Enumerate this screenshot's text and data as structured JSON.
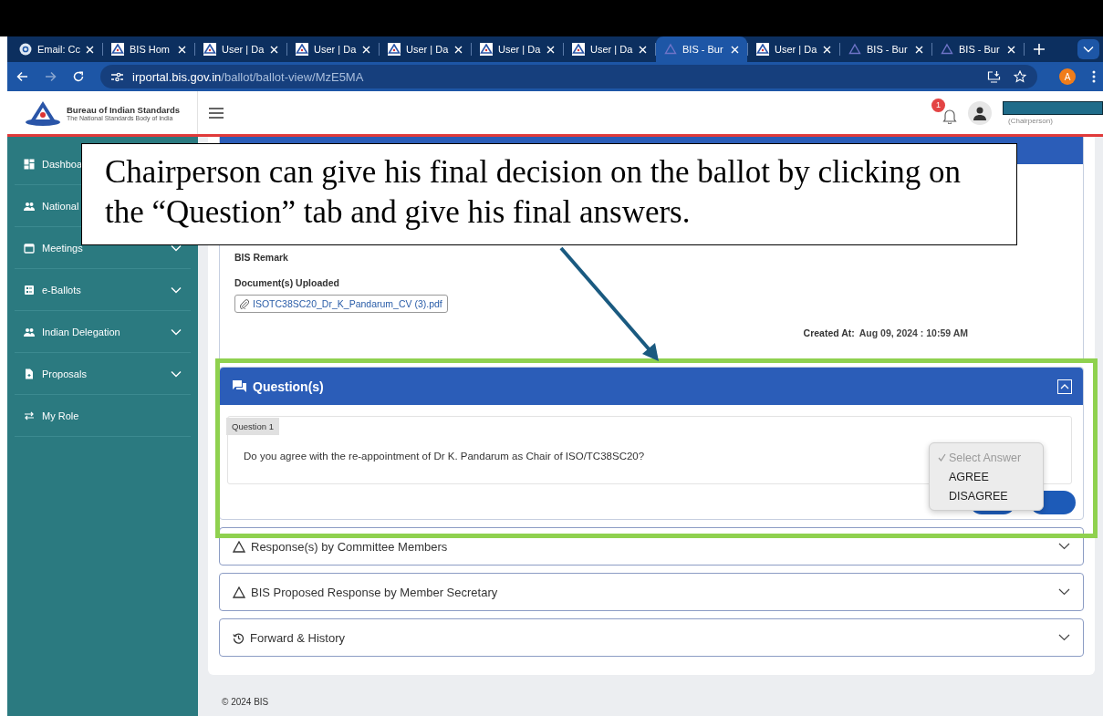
{
  "browser": {
    "tabs": [
      {
        "title": "Email: Cc",
        "kind": "mail",
        "selected": false
      },
      {
        "title": "BIS Hom",
        "kind": "bis",
        "selected": false
      },
      {
        "title": "User | Da",
        "kind": "bis",
        "selected": false
      },
      {
        "title": "User | Da",
        "kind": "bis",
        "selected": false
      },
      {
        "title": "User | Da",
        "kind": "bis",
        "selected": false
      },
      {
        "title": "User | Da",
        "kind": "bis",
        "selected": false
      },
      {
        "title": "User | Da",
        "kind": "bis",
        "selected": false
      },
      {
        "title": "BIS - Bur",
        "kind": "triangle",
        "selected": true
      },
      {
        "title": "User | Da",
        "kind": "bis",
        "selected": false
      },
      {
        "title": "BIS - Bur",
        "kind": "triangle",
        "selected": false
      },
      {
        "title": "BIS - Bur",
        "kind": "triangle",
        "selected": false
      }
    ],
    "address": {
      "host": "irportal.bis.gov.in",
      "path": "/ballot/ballot-view/MzE5MA"
    },
    "profile": "A"
  },
  "header": {
    "org_name": "Bureau of Indian Standards",
    "org_tagline": "The National Standards Body of India",
    "notification_count": "1",
    "user_role": "(Chairperson)"
  },
  "sidebar": {
    "items": [
      {
        "label": "Dashboa",
        "kind": "dashboard"
      },
      {
        "label": "National",
        "kind": "people"
      },
      {
        "label": "Meetings",
        "kind": "calendar",
        "chevron": true
      },
      {
        "label": "e-Ballots",
        "kind": "ballot",
        "chevron": true
      },
      {
        "label": "Indian Delegation",
        "kind": "people",
        "chevron": true
      },
      {
        "label": "Proposals",
        "kind": "file",
        "chevron": true
      },
      {
        "label": "My Role",
        "kind": "swap",
        "chevron": false
      }
    ]
  },
  "ballot_detail": {
    "remark_label": "BIS Remark",
    "documents_label": "Document(s) Uploaded",
    "document": "ISOTC38SC20_Dr_K_Pandarum_CV (3).pdf",
    "created_label": "Created At:",
    "created_value": "Aug 09, 2024 : 10:59 AM"
  },
  "questions": {
    "title": "Question(s)",
    "expanded": true,
    "items": [
      {
        "tag": "Question 1",
        "text": "Do you agree with the re-appointment of Dr K. Pandarum as Chair of ISO/TC38SC20?",
        "answer_options": [
          {
            "label": "Select Answer",
            "selected": true,
            "disabled": true
          },
          {
            "label": "AGREE",
            "selected": false,
            "disabled": false
          },
          {
            "label": "DISAGREE",
            "selected": false,
            "disabled": false
          }
        ]
      }
    ]
  },
  "sections": [
    {
      "title": "Response(s) by Committee Members",
      "kind": "warning",
      "expanded": false
    },
    {
      "title": "BIS Proposed Response by Member Secretary",
      "kind": "warning",
      "expanded": false
    },
    {
      "title": "Forward & History",
      "kind": "history",
      "expanded": false
    }
  ],
  "footer": "© 2024 BIS",
  "callout": {
    "text": "Chairperson can give his final decision on the ballot by clicking on the “Question” tab and give his final answers."
  }
}
